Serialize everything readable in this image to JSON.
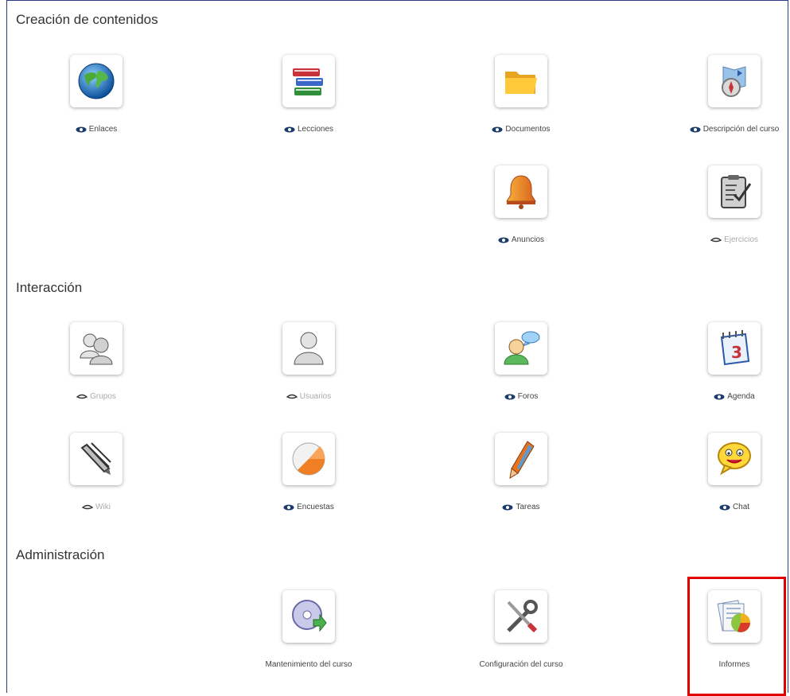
{
  "sections": {
    "content": {
      "title": "Creación de contenidos"
    },
    "interaction": {
      "title": "Interacción"
    },
    "admin": {
      "title": "Administración"
    }
  },
  "tools": {
    "links": {
      "label": "Enlaces",
      "icon": "globe-icon",
      "visible": true
    },
    "lessons": {
      "label": "Lecciones",
      "icon": "books-icon",
      "visible": true
    },
    "documents": {
      "label": "Documentos",
      "icon": "folder-icon",
      "visible": true
    },
    "course_description": {
      "label": "Descripción del curso",
      "icon": "compass-map-icon",
      "visible": true
    },
    "announcements": {
      "label": "Anuncios",
      "icon": "bell-icon",
      "visible": true
    },
    "exercises": {
      "label": "Ejercicios",
      "icon": "clipboard-check-icon",
      "visible": false
    },
    "groups": {
      "label": "Grupos",
      "icon": "group-users-icon",
      "visible": false
    },
    "users": {
      "label": "Usuarios",
      "icon": "user-icon",
      "visible": false
    },
    "forums": {
      "label": "Foros",
      "icon": "forum-chat-icon",
      "visible": true
    },
    "agenda": {
      "label": "Agenda",
      "icon": "calendar-icon",
      "visible": true
    },
    "wiki": {
      "label": "Wiki",
      "icon": "pencils-icon",
      "visible": false
    },
    "surveys": {
      "label": "Encuestas",
      "icon": "pie-icon",
      "visible": true
    },
    "assignments": {
      "label": "Tareas",
      "icon": "pen-icon",
      "visible": true
    },
    "chat": {
      "label": "Chat",
      "icon": "smiley-icon",
      "visible": true
    },
    "maintenance": {
      "label": "Mantenimiento del curso",
      "icon": "disc-download-icon"
    },
    "settings": {
      "label": "Configuración del curso",
      "icon": "tools-icon"
    },
    "reports": {
      "label": "Informes",
      "icon": "report-chart-icon"
    }
  },
  "colors": {
    "frame": "#2a3a86",
    "highlight": "#e00000"
  }
}
